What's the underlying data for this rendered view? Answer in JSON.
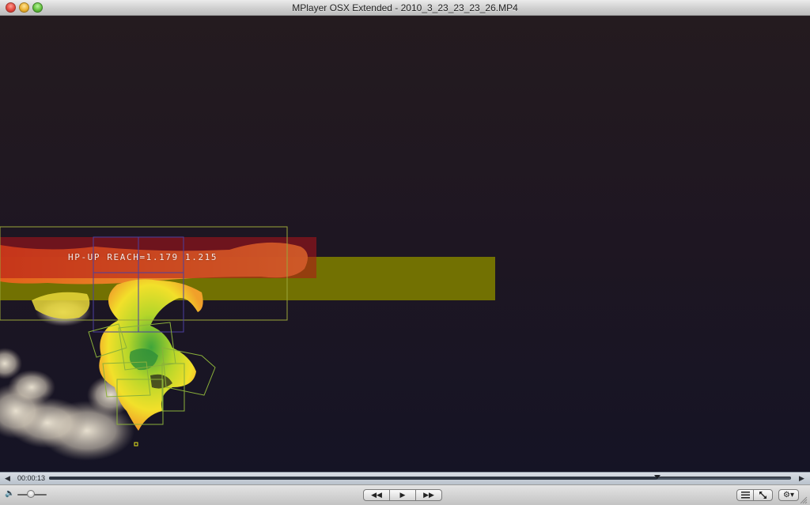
{
  "window": {
    "title": "MPlayer OSX Extended - 2010_3_23_23_23_26.MP4"
  },
  "video": {
    "overlay_text": "HP-UP REACH=1.179 1.215"
  },
  "seekbar": {
    "time": "00:00:13",
    "progress": 0.82
  },
  "controls": {
    "volume": 0.45,
    "icons": {
      "volume": "speaker-icon",
      "rewind": "rewind-icon",
      "play": "play-icon",
      "fast_forward": "fast-forward-icon",
      "playlist": "playlist-icon",
      "fullscreen": "fullscreen-icon",
      "settings": "gear-icon"
    }
  }
}
